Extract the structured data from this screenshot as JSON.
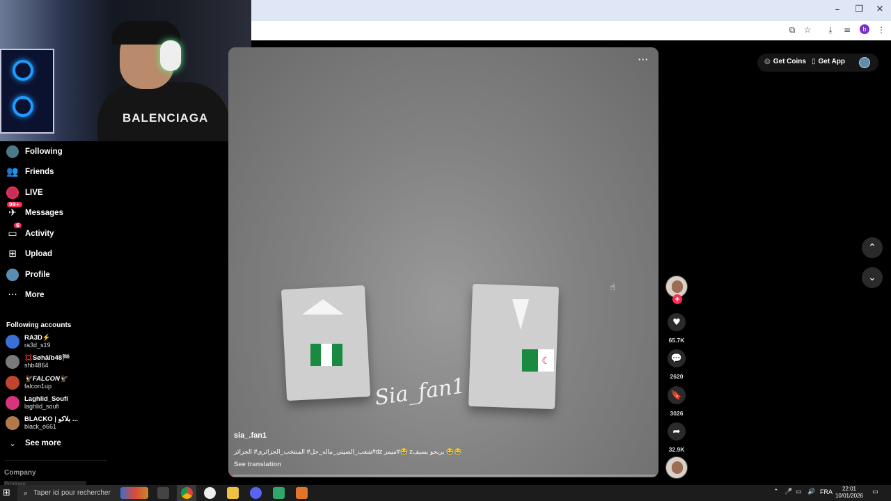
{
  "browser": {
    "window_controls": {
      "minimize": "–",
      "maximize": "❐",
      "close": "✕"
    },
    "toolbar_icons": [
      "install-icon",
      "star-icon",
      "download-icon",
      "reading-list-icon",
      "profile-icon",
      "menu-icon"
    ],
    "profile_initial": "b"
  },
  "webcam": {
    "hoodie_text": "BALENCIAGA"
  },
  "sidebar": {
    "nav": [
      {
        "label": "Following",
        "icon": "following-icon"
      },
      {
        "label": "Friends",
        "icon": "friends-icon"
      },
      {
        "label": "LIVE",
        "icon": "live-icon"
      },
      {
        "label": "Messages",
        "icon": "messages-icon",
        "badge": "99+"
      },
      {
        "label": "Activity",
        "icon": "activity-icon",
        "badge": "6"
      },
      {
        "label": "Upload",
        "icon": "upload-icon"
      },
      {
        "label": "Profile",
        "icon": "profile-icon"
      },
      {
        "label": "More",
        "icon": "more-icon"
      }
    ],
    "following_title": "Following accounts",
    "accounts": [
      {
        "name": "RA3D⚡",
        "handle": "ra3d_s19",
        "color": "#3b6fd6"
      },
      {
        "name": "💢Søhāīb48🏁",
        "handle": "shb4864",
        "color": "#7a7a7a"
      },
      {
        "name": "🦅FALCON🦅",
        "handle": "falcon1up",
        "color": "#c0452f"
      },
      {
        "name": "Laghlid_Soufi",
        "handle": "laghlid_soufi",
        "color": "#d8337e"
      },
      {
        "name": "BLACKO | بلاكو ...",
        "handle": "black_o661",
        "color": "#b07a4a"
      }
    ],
    "see_more": "See more",
    "company": "Company",
    "company_sub": "Program"
  },
  "topright": {
    "get_coins": "Get Coins",
    "get_app": "Get App"
  },
  "video": {
    "more_dots": "···",
    "signature": "Sia_fan1",
    "username": "sia_.fan1",
    "caption": "شعب_الصيني_ماله_حل# المنتخب_الجزائري# الجزائر#dz ميمز#😂 zيربحو بسيف 😂😂",
    "see_translation": "See translation",
    "progress": 0.01
  },
  "actions": {
    "likes": "65.7K",
    "comments": "2620",
    "saves": "3026",
    "shares": "32.9K"
  },
  "taskbar": {
    "search_placeholder": "Taper ici pour rechercher",
    "lang": "FRA",
    "time": "22:01",
    "date": "10/01/2026"
  }
}
